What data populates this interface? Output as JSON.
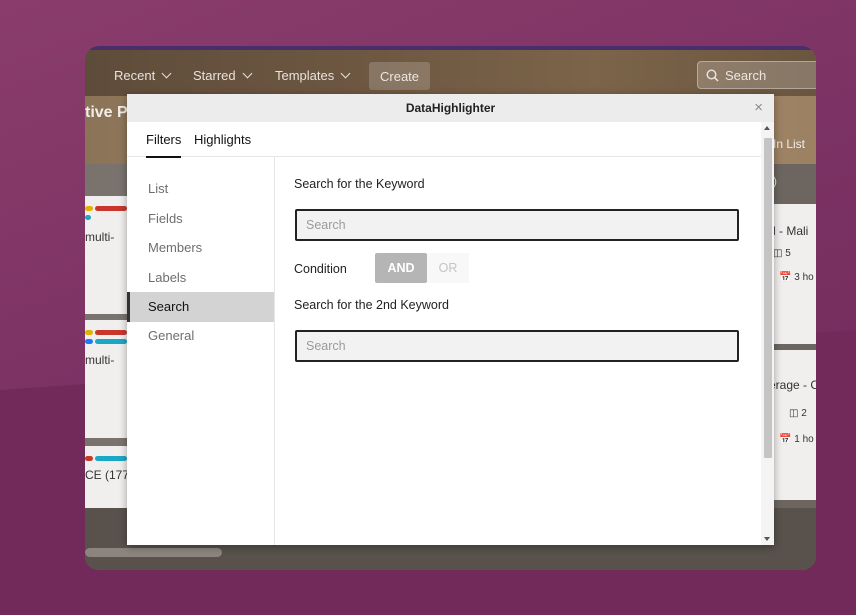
{
  "header": {
    "nav": [
      {
        "label": "Recent"
      },
      {
        "label": "Starred"
      },
      {
        "label": "Templates"
      }
    ],
    "create_label": "Create",
    "search_placeholder": "Search"
  },
  "board": {
    "title_fragment": "tive P",
    "in_list_fragment": "In List",
    "right_col_header_fragment": ")",
    "left_cards": [
      {
        "text": "multi-"
      },
      {
        "text": "multi-"
      },
      {
        "text": "CE (177"
      }
    ],
    "right_cards": [
      {
        "title": "d - Mali",
        "count": "5",
        "time": "3 ho"
      },
      {
        "title": "erage - C",
        "count": "2",
        "time": "1 ho"
      }
    ],
    "label_colors": [
      "#e2b203",
      "#c9372c",
      "#1d7afc",
      "#22a06b",
      "#1ba8c6"
    ]
  },
  "modal": {
    "title": "DataHighlighter",
    "close_glyph": "×",
    "tabs": [
      {
        "label": "Filters",
        "active": true
      },
      {
        "label": "Highlights",
        "active": false
      }
    ],
    "sidebar": [
      {
        "label": "List"
      },
      {
        "label": "Fields"
      },
      {
        "label": "Members"
      },
      {
        "label": "Labels"
      },
      {
        "label": "Search",
        "active": true
      },
      {
        "label": "General"
      }
    ],
    "search": {
      "keyword_label": "Search for the Keyword",
      "keyword_placeholder": "Search",
      "condition_label": "Condition",
      "and_label": "AND",
      "or_label": "OR",
      "selected_condition": "AND",
      "second_keyword_label": "Search for the 2nd Keyword",
      "second_keyword_placeholder": "Search"
    }
  }
}
